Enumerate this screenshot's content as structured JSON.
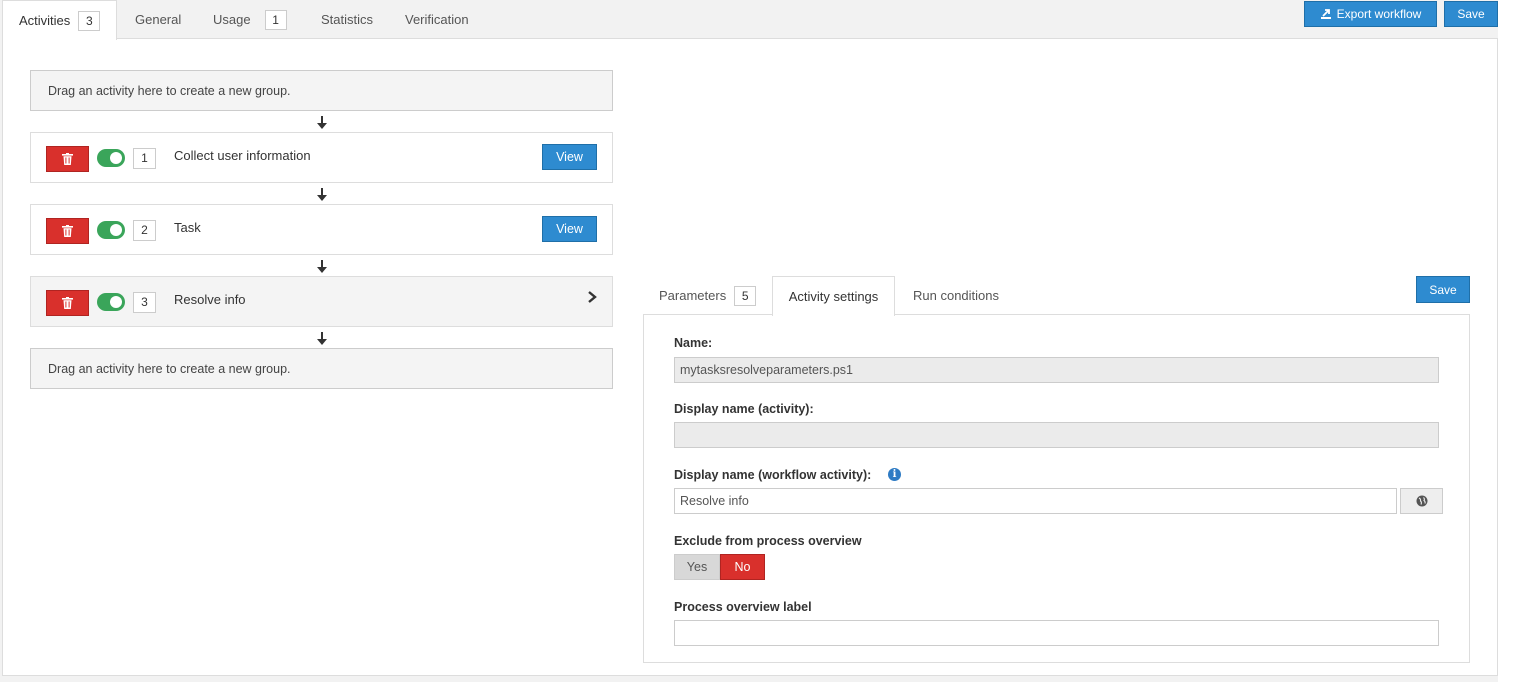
{
  "tabs": [
    {
      "label": "Activities",
      "badge": "3"
    },
    {
      "label": "General"
    },
    {
      "label": "Usage",
      "badge": "1"
    },
    {
      "label": "Statistics"
    },
    {
      "label": "Verification"
    }
  ],
  "toolbar": {
    "export_label": "Export workflow",
    "save_label": "Save"
  },
  "dropzone_text": "Drag an activity here to create a new group.",
  "activities": [
    {
      "number": "1",
      "label": "Collect user information",
      "view_label": "View",
      "enabled": true
    },
    {
      "number": "2",
      "label": "Task",
      "view_label": "View",
      "enabled": true
    },
    {
      "number": "3",
      "label": "Resolve info",
      "enabled": true,
      "selected": true
    }
  ],
  "detail": {
    "tabs": [
      {
        "label": "Parameters",
        "badge": "5"
      },
      {
        "label": "Activity settings"
      },
      {
        "label": "Run conditions"
      }
    ],
    "save_label": "Save",
    "name_label": "Name:",
    "name_value": "mytasksresolveparameters.ps1",
    "display_name_activity_label": "Display name (activity):",
    "display_name_activity_value": "",
    "display_name_workflow_label": "Display name (workflow activity):",
    "display_name_workflow_value": "Resolve info",
    "exclude_label": "Exclude from process overview",
    "exclude_yes": "Yes",
    "exclude_no": "No",
    "exclude_selected": "No",
    "overview_label_label": "Process overview label",
    "overview_label_value": ""
  },
  "colors": {
    "primary": "#2e8bd0",
    "danger": "#d9302c",
    "toggle_on": "#3aa55a"
  }
}
